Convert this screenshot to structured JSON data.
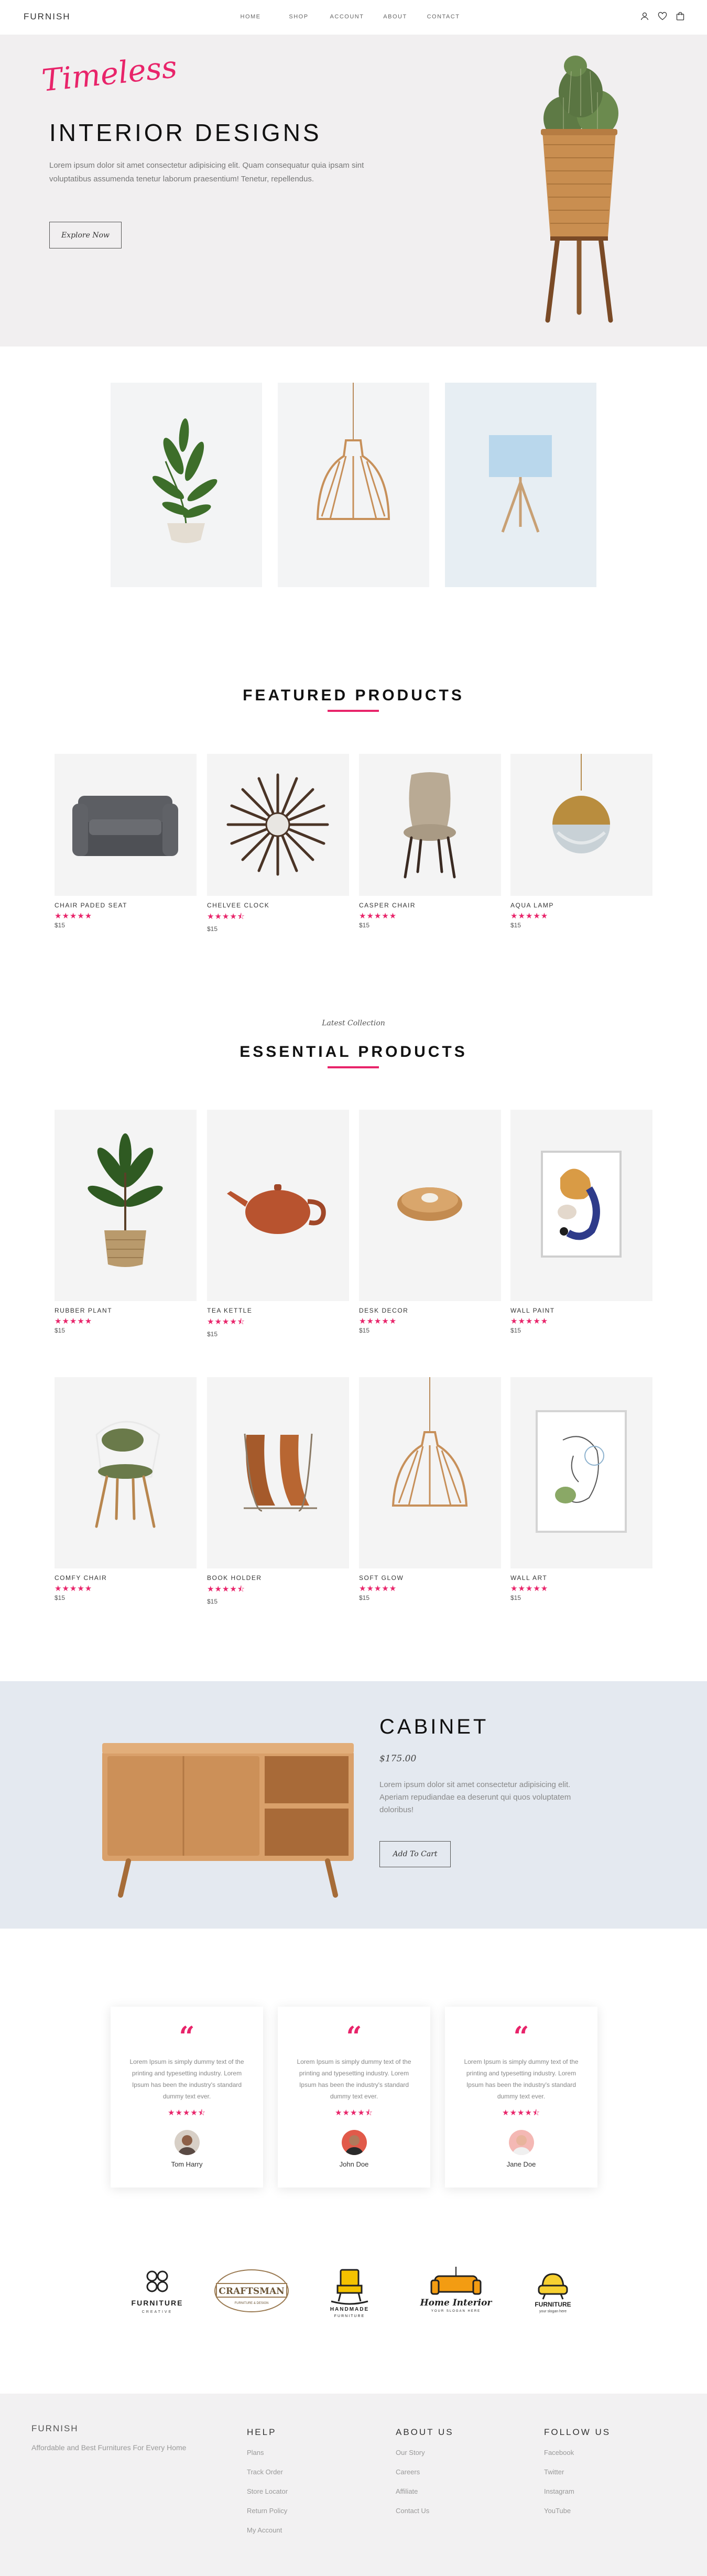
{
  "header": {
    "logo": "FURNISH",
    "nav": [
      "HOME",
      "SHOP",
      "ACCOUNT",
      "ABOUT",
      "CONTACT"
    ],
    "icons": [
      "user-icon",
      "heart-icon",
      "cart-icon"
    ]
  },
  "hero": {
    "script": "Timeless",
    "title": "INTERIOR DESIGNS",
    "text": "Lorem ipsum dolor sit amet consectetur adipisicing elit. Quam consequatur quia ipsam sint voluptatibus assumenda tenetur laborum praesentium! Tenetur, repellendus.",
    "button": "Explore Now"
  },
  "featured": {
    "title": "FEATURED PRODUCTS",
    "products": [
      {
        "name": "CHAIR PADED SEAT",
        "stars": "★★★★★",
        "rating": 5,
        "price": "$15"
      },
      {
        "name": "CHELVEE CLOCK",
        "stars": "★★★★⯪",
        "rating": 4.5,
        "price": "$15"
      },
      {
        "name": "CASPER CHAIR",
        "stars": "★★★★★",
        "rating": 5,
        "price": "$15"
      },
      {
        "name": "AQUA LAMP",
        "stars": "★★★★★",
        "rating": 5,
        "price": "$15"
      }
    ]
  },
  "essential": {
    "subtitle": "Latest Collection",
    "title": "ESSENTIAL PRODUCTS",
    "products": [
      {
        "name": "RUBBER PLANT",
        "stars": "★★★★★",
        "rating": 5,
        "price": "$15"
      },
      {
        "name": "TEA KETTLE",
        "stars": "★★★★⯪",
        "rating": 4.5,
        "price": "$15"
      },
      {
        "name": "DESK DECOR",
        "stars": "★★★★★",
        "rating": 5,
        "price": "$15"
      },
      {
        "name": "WALL PAINT",
        "stars": "★★★★★",
        "rating": 5,
        "price": "$15"
      },
      {
        "name": "COMFY CHAIR",
        "stars": "★★★★★",
        "rating": 5,
        "price": "$15"
      },
      {
        "name": "BOOK HOLDER",
        "stars": "★★★★⯪",
        "rating": 4.5,
        "price": "$15"
      },
      {
        "name": "SOFT GLOW",
        "stars": "★★★★★",
        "rating": 5,
        "price": "$15"
      },
      {
        "name": "WALL ART",
        "stars": "★★★★★",
        "rating": 5,
        "price": "$15"
      }
    ]
  },
  "cabinet": {
    "title": "CABINET",
    "price": "$175.00",
    "text": "Lorem ipsum dolor sit amet consectetur adipisicing elit. Aperiam repudiandae ea deserunt qui quos voluptatem doloribus!",
    "button": "Add To Cart"
  },
  "testimonials": [
    {
      "text": "Lorem Ipsum is simply dummy text of the printing and typesetting industry. Lorem Ipsum has been the industry's standard dummy text ever.",
      "stars": "★★★★⯪",
      "rating": 4.5,
      "name": "Tom Harry"
    },
    {
      "text": "Lorem Ipsum is simply dummy text of the printing and typesetting industry. Lorem Ipsum has been the industry's standard dummy text ever.",
      "stars": "★★★★⯪",
      "rating": 4.5,
      "name": "John Doe"
    },
    {
      "text": "Lorem Ipsum is simply dummy text of the printing and typesetting industry. Lorem Ipsum has been the industry's standard dummy text ever.",
      "stars": "★★★★⯪",
      "rating": 4.5,
      "name": "Jane Doe"
    }
  ],
  "brands": [
    {
      "name": "FURNITURE",
      "sub": "CREATIVE"
    },
    {
      "name": "CRAFTSMAN",
      "sub": "FURNITURE & DESIGN"
    },
    {
      "name": "HANDMADE",
      "sub": "FURNITURE"
    },
    {
      "name": "Home Interior",
      "sub": "YOUR SLOGAN HERE"
    },
    {
      "name": "FURNITURE",
      "sub": "your slogan here"
    }
  ],
  "footer": {
    "logo": "FURNISH",
    "tagline": "Affordable and Best Furnitures For Every Home",
    "help": {
      "title": "HELP",
      "links": [
        "Plans",
        "Track Order",
        "Store Locator",
        "Return Policy",
        "My Account"
      ]
    },
    "about": {
      "title": "ABOUT US",
      "links": [
        "Our Story",
        "Careers",
        "Affiliate",
        "Contact Us"
      ]
    },
    "follow": {
      "title": "FOLLOW US",
      "links": [
        "Facebook",
        "Twitter",
        "Instagram",
        "YouTube"
      ]
    }
  },
  "colors": {
    "accent": "#e8246a",
    "hero_bg": "#f1eff0",
    "cabinet_bg": "#e4e9f0",
    "footer_bg": "#f2f1f2"
  }
}
